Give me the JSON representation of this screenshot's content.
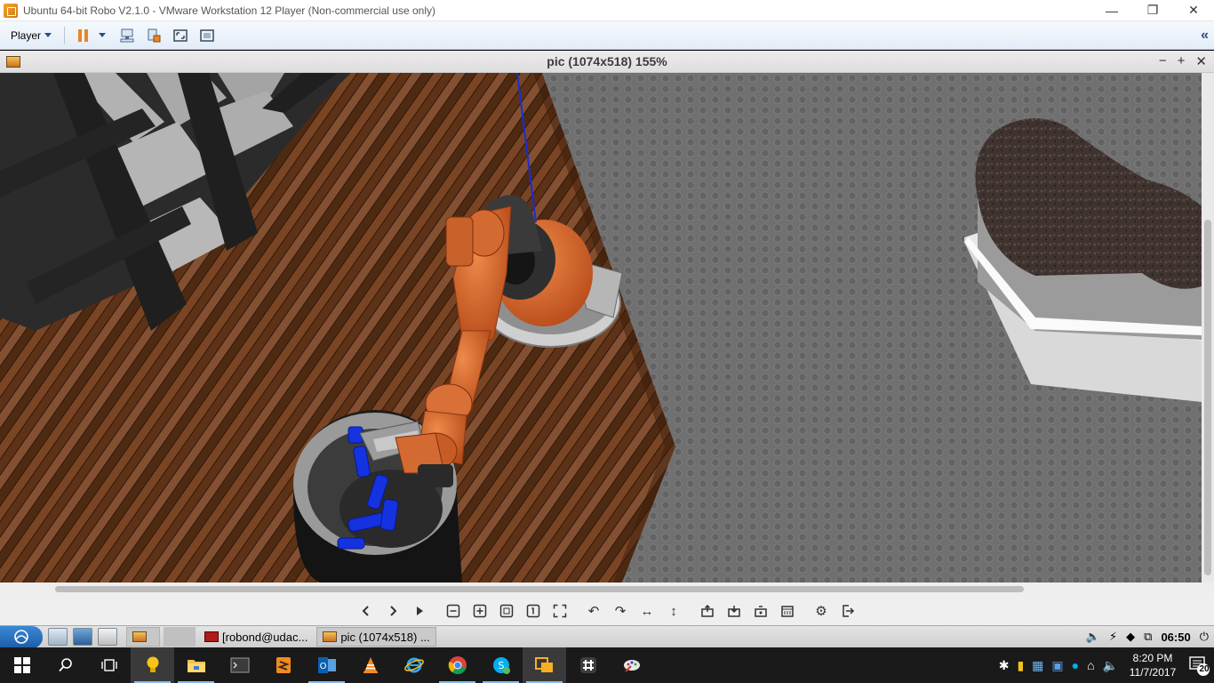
{
  "vm_window": {
    "title": "Ubuntu 64-bit Robo V2.1.0 - VMware Workstation 12 Player (Non-commercial use only)",
    "minimize": "—",
    "restore": "❐",
    "close": "✕"
  },
  "vm_toolbar": {
    "player_label": "Player",
    "collapse": "«"
  },
  "viewer": {
    "title": "pic (1074x518) 155%",
    "minimize": "−",
    "maximize": "+",
    "close": "✕"
  },
  "viewer_toolbar": {
    "prev": "‹",
    "next": "›",
    "play": "▶",
    "zoom_out": "⊟",
    "zoom_in": "⊞",
    "fit": "⛶",
    "actual_size": "1",
    "fullscreen": "⛶",
    "rotate_ccw": "↶",
    "rotate_cw": "↷",
    "flip_h": "↔",
    "flip_v": "↕",
    "open": "⏏",
    "save": "⏏",
    "save_as": "⏏",
    "delete": "▦",
    "prefs": "⚙",
    "quit": "⇥"
  },
  "lx_panel": {
    "tasks": [
      {
        "label": "[robond@udac..."
      },
      {
        "label": "pic (1074x518) ..."
      }
    ],
    "time": "06:50"
  },
  "win_taskbar": {
    "time": "8:20 PM",
    "date": "11/7/2017",
    "notifications": "20"
  },
  "colors": {
    "robot_orange": "#d9642a",
    "floor_wood": "#6b3a1d",
    "floor_tile": "#7a7a7a",
    "bin_gray": "#8a8a8a",
    "target_blue": "#1432e0",
    "accent_blue": "#2a4f82"
  }
}
